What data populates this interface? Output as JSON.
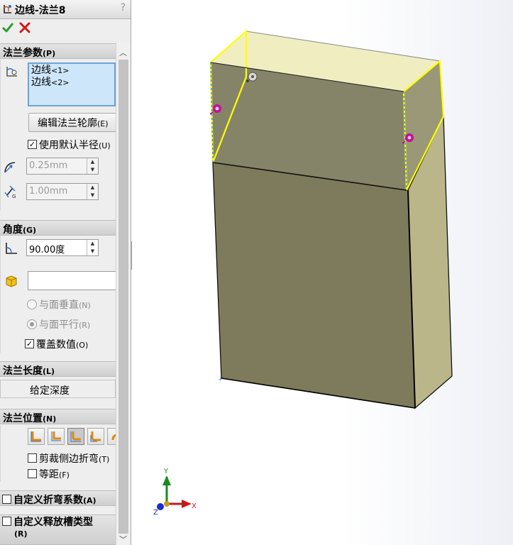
{
  "window": {
    "title": "边线-法兰8",
    "help": "?"
  },
  "actions": {
    "ok": "ok",
    "cancel": "cancel"
  },
  "flange_params": {
    "header": "法兰参数",
    "header_key": "(P)",
    "edges": [
      {
        "label": "边线",
        "index": "<1>"
      },
      {
        "label": "边线",
        "index": "<2>"
      }
    ],
    "edit_profile_button": "编辑法兰轮廓",
    "edit_profile_key": "(E)",
    "use_default_radius": {
      "label": "使用默认半径",
      "key": "(U)",
      "checked": true
    },
    "bend_radius": "0.25mm",
    "gap": "1.00mm"
  },
  "angle": {
    "header": "角度",
    "header_key": "(G)",
    "value": "90.00度",
    "reference_placeholder": "",
    "perpendicular": {
      "label": "与面垂直",
      "key": "(N)",
      "selected": false
    },
    "parallel": {
      "label": "与面平行",
      "key": "(R)",
      "selected": true
    },
    "override": {
      "label": "覆盖数值",
      "key": "(O)",
      "checked": true
    }
  },
  "flange_length": {
    "header": "法兰长度",
    "header_key": "(L)",
    "end_condition": "给定深度"
  },
  "flange_position": {
    "header": "法兰位置",
    "header_key": "(N)",
    "trim_side_bends": {
      "label": "剪裁侧边折弯",
      "key": "(T)",
      "checked": false
    },
    "offset": {
      "label": "等距",
      "key": "(F)",
      "checked": false
    }
  },
  "custom_bend_allowance": {
    "label": "自定义折弯系数",
    "key": "(A)",
    "checked": false
  },
  "custom_relief_type": {
    "label": "自定义释放槽类型",
    "key": "(R)",
    "checked": false
  },
  "triad": {
    "x": "X",
    "y": "Y",
    "z": "Z"
  },
  "colors": {
    "accent_yellow": "#ffff00",
    "face_front": "#7e7b5c",
    "face_side": "#bab68a",
    "face_top": "#f0eec0",
    "handle_magenta": "#c0119a",
    "ok_green": "#2e9e2e",
    "cancel_red": "#d01818"
  }
}
